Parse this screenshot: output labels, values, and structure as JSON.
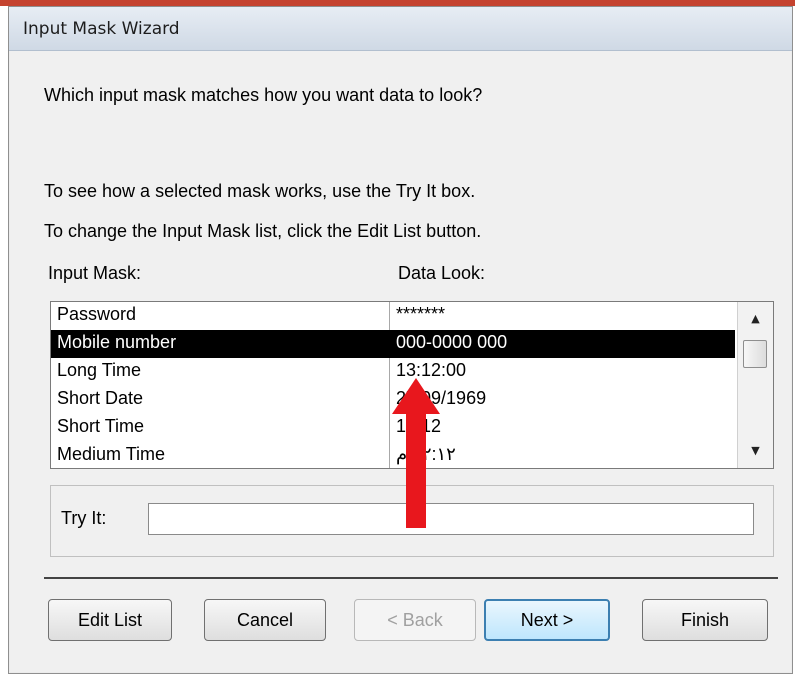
{
  "window": {
    "title": "Input Mask Wizard"
  },
  "instructions": {
    "question": "Which input mask matches how you want data to look?",
    "try_hint": "To see how a selected mask works, use the Try It box.",
    "edit_hint": "To change the Input Mask list, click the Edit List button."
  },
  "list": {
    "col1_header": "Input Mask:",
    "col2_header": "Data Look:",
    "rows": [
      {
        "mask": "Password",
        "look": "*******"
      },
      {
        "mask": "Mobile number",
        "look": "000-0000 000"
      },
      {
        "mask": "Long Time",
        "look": "13:12:00"
      },
      {
        "mask": "Short Date",
        "look": "27/09/1969"
      },
      {
        "mask": "Short Time",
        "look": "13:12"
      },
      {
        "mask": "Medium Time",
        "look": "١٢:١٢ م"
      }
    ],
    "selected_index": 1
  },
  "tryit": {
    "label": "Try It:",
    "value": ""
  },
  "buttons": {
    "edit_list": "Edit List",
    "cancel": "Cancel",
    "back": "< Back",
    "next": "Next >",
    "finish": "Finish"
  },
  "colors": {
    "annotation_arrow": "#e8171d",
    "selection": "#000000",
    "accent": "#c5432f"
  }
}
